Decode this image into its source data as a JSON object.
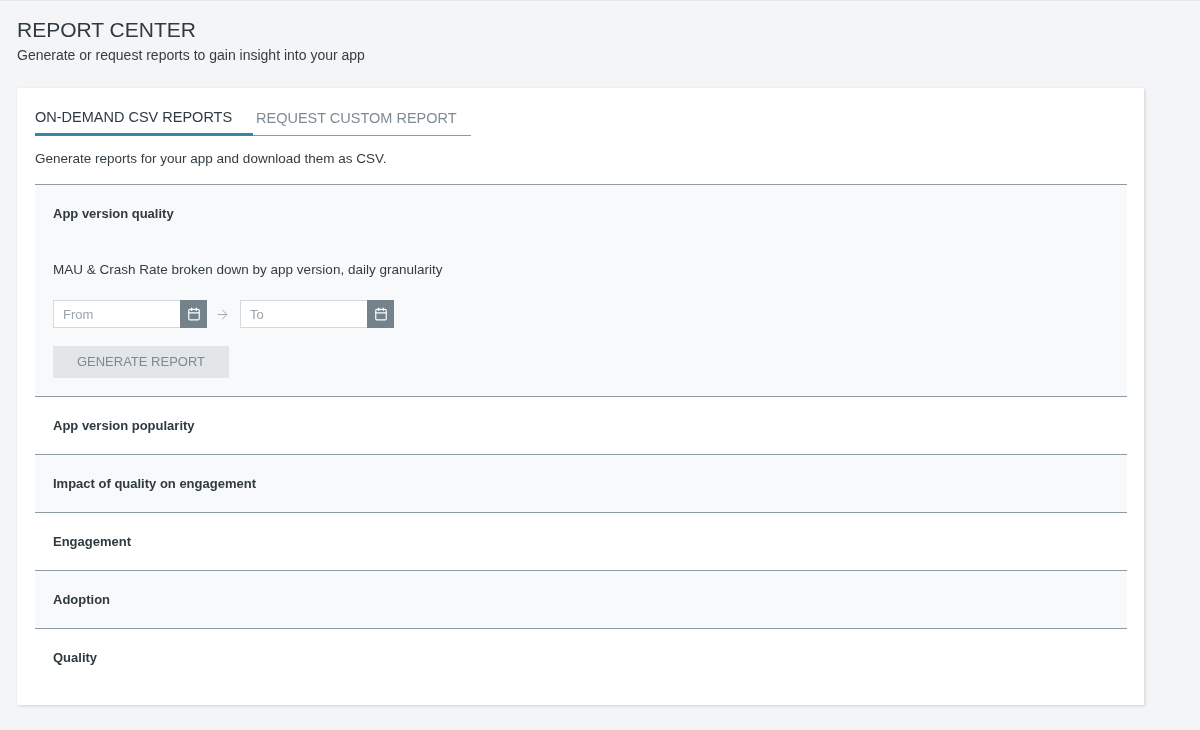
{
  "page": {
    "title": "REPORT CENTER",
    "subtitle": "Generate or request reports to gain insight into your app"
  },
  "tabs": [
    {
      "label": "ON-DEMAND CSV REPORTS",
      "selected": true
    },
    {
      "label": "REQUEST CUSTOM REPORT",
      "selected": false
    }
  ],
  "tab_description": "Generate reports for your app and download them as CSV.",
  "reports": [
    {
      "title": "App version quality",
      "description": "MAU & Crash Rate broken down by app version, daily granularity",
      "date_range": {
        "from": {
          "placeholder": "From"
        },
        "to": {
          "placeholder": "To"
        }
      },
      "generate_button": {
        "label": "GENERATE REPORT",
        "disabled": true
      }
    },
    {
      "title": "App version popularity"
    },
    {
      "title": "Impact of quality on engagement"
    },
    {
      "title": "Engagement"
    },
    {
      "title": "Adoption"
    },
    {
      "title": "Quality"
    }
  ]
}
